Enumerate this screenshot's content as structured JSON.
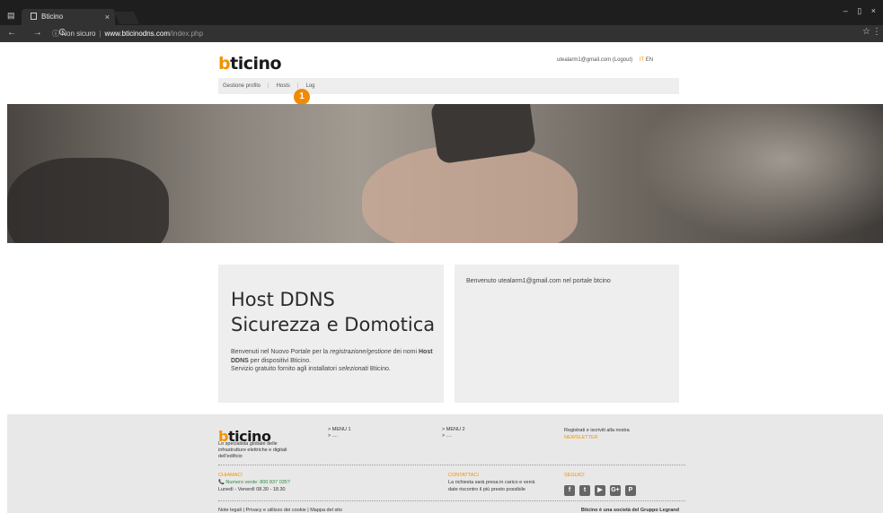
{
  "browser": {
    "tab_title": "Bticino",
    "tab_close": "×",
    "nav_buttons": "← → C",
    "insecure_label": "ⓘ Non sicuro",
    "url_separator": "|",
    "url_host": "www.bticinodns.com",
    "url_path": "/index.php",
    "window_controls": "– ▯ ×",
    "star_icon": "☆",
    "more_icon": "⋮"
  },
  "header": {
    "logo_b": "b",
    "logo_rest": "ticino",
    "user_email": "utealarm1@gmail.com",
    "logout": "(Logout)",
    "lang_it": "IT",
    "lang_en": "EN"
  },
  "nav": {
    "items": [
      {
        "label": "Gestione profilo"
      },
      {
        "label": "Hosts"
      },
      {
        "label": "Log"
      }
    ],
    "separator": "|",
    "badge": "1"
  },
  "main": {
    "title_line1": "Host DDNS",
    "title_line2": "Sicurezza e Domotica",
    "p1_a": "Benvenuti nel Nuovo Portale per la ",
    "p1_em": "registrazione/gestione",
    "p1_b": " dei nomi ",
    "p1_bold": "Host DDNS",
    "p1_c": " per dispositivi Bticino.",
    "p2_a": "Servizio gratuito fornito agli installatori ",
    "p2_em": "selezionati",
    "p2_b": " Bticino.",
    "welcome": "Benvenuto utealarm1@gmail.com nel portale btcino"
  },
  "footer": {
    "logo_b": "b",
    "logo_rest": "ticino",
    "tagline": "Lo specialista globale delle infrastrutture elettriche e digitali dell'edificio",
    "menu1_title": "> MENU 1",
    "menu1_item": "> ....",
    "menu2_title": "> MENU 2",
    "menu2_item": "> ....",
    "newsletter_text": "Registrati e iscriviti alla nostra",
    "newsletter_link": "NEWSLETTER",
    "call_title": "CHIAMACI",
    "call_phone": "📞 Numero verde: 800 837 035?",
    "call_hours": "Lunedì - Venerdì 08.30 - 18.30",
    "contact_title": "CONTATTACI",
    "contact_line1": "La richiesta sarà presa in carico e verrà",
    "contact_line2": "date riscontro il più presto possibile",
    "follow_title": "SEGUICI",
    "socials": [
      "f",
      "t",
      "▶",
      "G+",
      "P"
    ],
    "bottom_links": "Note legali   |  Privacy e utilizzo dei cookie   |  Mappa del sito",
    "legrand": "Bticino è una società del Gruppo Legrand"
  }
}
